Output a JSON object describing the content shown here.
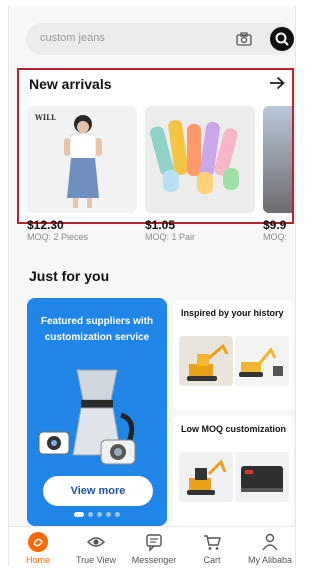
{
  "search": {
    "placeholder": "custom jeans",
    "camera_icon": "camera-icon",
    "search_icon": "search-icon"
  },
  "new_arrivals": {
    "title": "New arrivals",
    "arrow_icon": "arrow-right-icon",
    "products": [
      {
        "price": "$12.30",
        "moq": "MOQ: 2 Pieces",
        "image": "woman in denim skirt",
        "brand_tag": "WILL"
      },
      {
        "price": "$1.05",
        "moq": "MOQ: 1 Pair",
        "image": "colorful socks"
      },
      {
        "price": "$9.9",
        "moq": "MOQ:",
        "image": "product thumbnail"
      }
    ]
  },
  "just_for_you": {
    "title": "Just for you",
    "featured": {
      "text": "Featured suppliers with customization service",
      "button": "View more",
      "image": "coffee maker and camera",
      "dots": 5,
      "active_dot": 0
    },
    "cards": [
      {
        "title": "Inspired by your history",
        "images": [
          "mini excavator",
          "excavator and parts"
        ]
      },
      {
        "title": "Low MOQ customization",
        "images": [
          "excavator",
          "battery pack"
        ]
      }
    ]
  },
  "bottom_nav": [
    {
      "label": "Home",
      "icon": "home-icon",
      "active": true
    },
    {
      "label": "True View",
      "icon": "eye-icon",
      "active": false
    },
    {
      "label": "Messenger",
      "icon": "message-icon",
      "active": false
    },
    {
      "label": "Cart",
      "icon": "cart-icon",
      "active": false
    },
    {
      "label": "My Alibaba",
      "icon": "user-icon",
      "active": false
    }
  ],
  "colors": {
    "accent": "#ff6a00",
    "highlight_border": "#b3242d",
    "featured_bg": "#1f86e8"
  }
}
